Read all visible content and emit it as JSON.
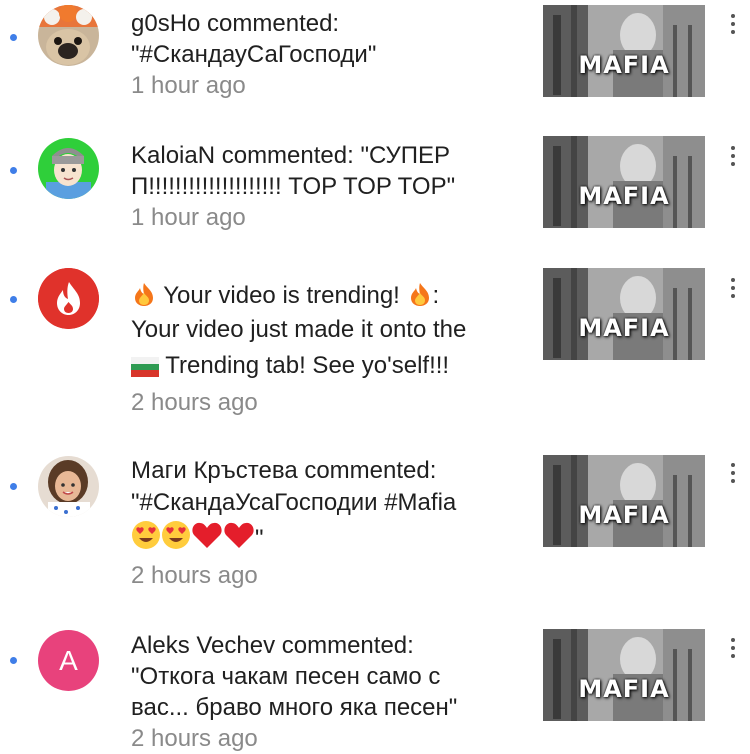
{
  "notifications": [
    {
      "avatar_icon": "pug-avatar-icon",
      "lines": [
        "g0sHo commented:",
        "\"#СкандауСаГосподи\""
      ],
      "time": "1 hour ago",
      "thumbnail_title": "MAFIA"
    },
    {
      "avatar_icon": "cartoon-boy-avatar-icon",
      "lines": [
        "KaloiaN commented: \"СУПЕР",
        "П!!!!!!!!!!!!!!!!!!!! TOP TOP TOP\""
      ],
      "time": "1 hour ago",
      "thumbnail_title": "MAFIA"
    },
    {
      "avatar_icon": "trending-flame-icon",
      "lines": [
        "Your video is trending!",
        ":",
        "Your video just made it onto the",
        "Trending tab! See yo'self!!!"
      ],
      "time": "2 hours ago",
      "thumbnail_title": "MAFIA"
    },
    {
      "avatar_icon": "girl-avatar-icon",
      "lines": [
        "Маги Кръстева commented:",
        "\"#СкандаУсаГосподии #Mafia",
        "\""
      ],
      "time": "2 hours ago",
      "thumbnail_title": "MAFIA"
    },
    {
      "avatar_icon": "letter-a-avatar-icon",
      "avatar_letter": "A",
      "lines": [
        "Aleks Vechev commented:",
        "\"Откога чакам песен само с",
        "вас... браво много яка песен\""
      ],
      "time": "2 hours ago",
      "thumbnail_title": "MAFIA"
    }
  ],
  "colors": {
    "unread_dot": "#3f7ee8",
    "time_text": "#8a8a8a",
    "flame_avatar": "#e0322b",
    "letter_avatar": "#e8427c"
  }
}
